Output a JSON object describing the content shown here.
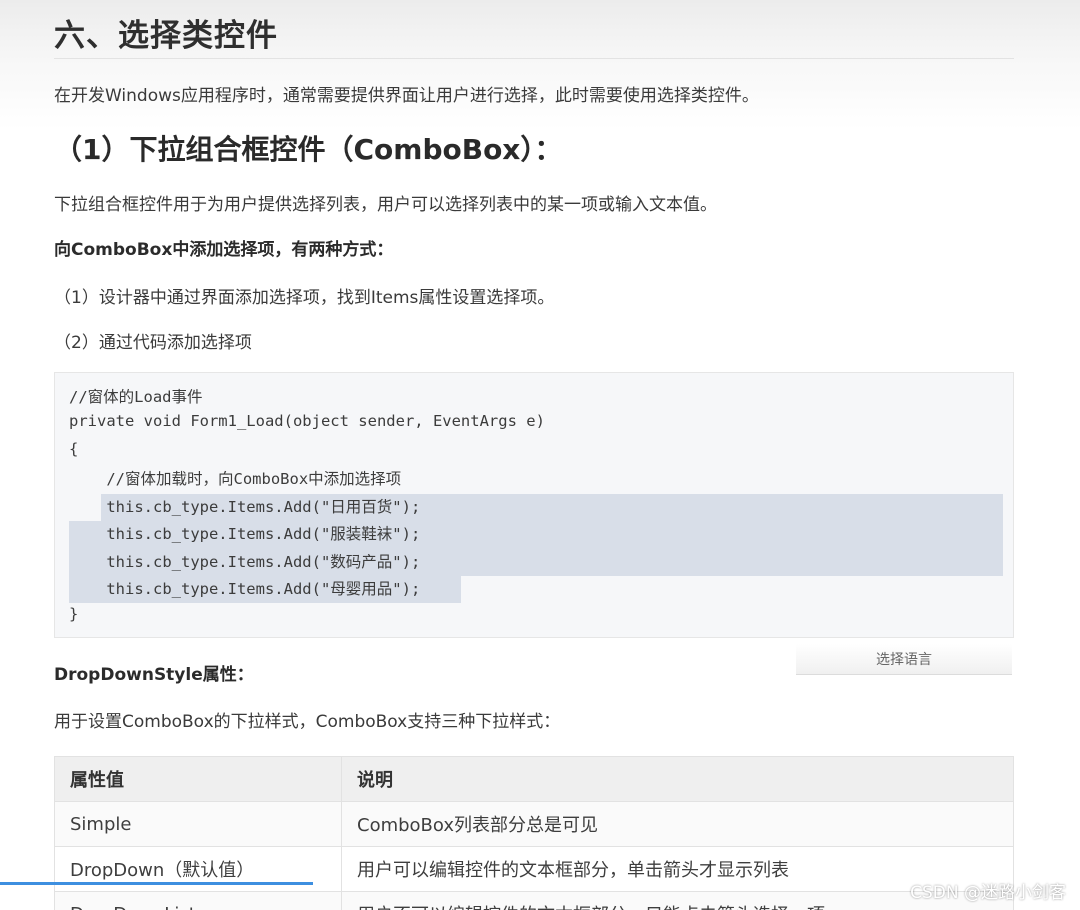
{
  "section": {
    "title": "六、选择类控件",
    "intro": "在开发Windows应用程序时，通常需要提供界面让用户进行选择，此时需要使用选择类控件。"
  },
  "combobox": {
    "heading": "（1）下拉组合框控件（ComboBox）：",
    "desc": "下拉组合框控件用于为用户提供选择列表，用户可以选择列表中的某一项或输入文本值。",
    "add_heading": "向ComboBox中添加选择项，有两种方式：",
    "way1": "（1）设计器中通过界面添加选择项，找到Items属性设置选择项。",
    "way2": "（2）通过代码添加选择项"
  },
  "code": {
    "lines": [
      "//窗体的Load事件",
      "private void Form1_Load(object sender, EventArgs e)",
      "{",
      "    //窗体加载时，向ComboBox中添加选择项",
      "    this.cb_type.Items.Add(\"日用百货\");",
      "    this.cb_type.Items.Add(\"服装鞋袜\");",
      "    this.cb_type.Items.Add(\"数码产品\");",
      "    this.cb_type.Items.Add(\"母婴用品\");",
      "}"
    ],
    "lang_button": "选择语言"
  },
  "dropdownstyle": {
    "heading": "DropDownStyle属性：",
    "desc": "用于设置ComboBox的下拉样式，ComboBox支持三种下拉样式：",
    "table": {
      "headers": [
        "属性值",
        "说明"
      ],
      "rows": [
        [
          "Simple",
          "ComboBox列表部分总是可见"
        ],
        [
          "DropDown（默认值）",
          "用户可以编辑控件的文本框部分，单击箭头才显示列表"
        ],
        [
          "DropDownList",
          "用户不可以编辑控件的文本框部分，只能点击箭头选择一项"
        ]
      ]
    }
  },
  "watermark": "CSDN @迷路小剑客",
  "colors": {
    "selection": "#d8dee8",
    "progress": "#3d8fe0"
  }
}
